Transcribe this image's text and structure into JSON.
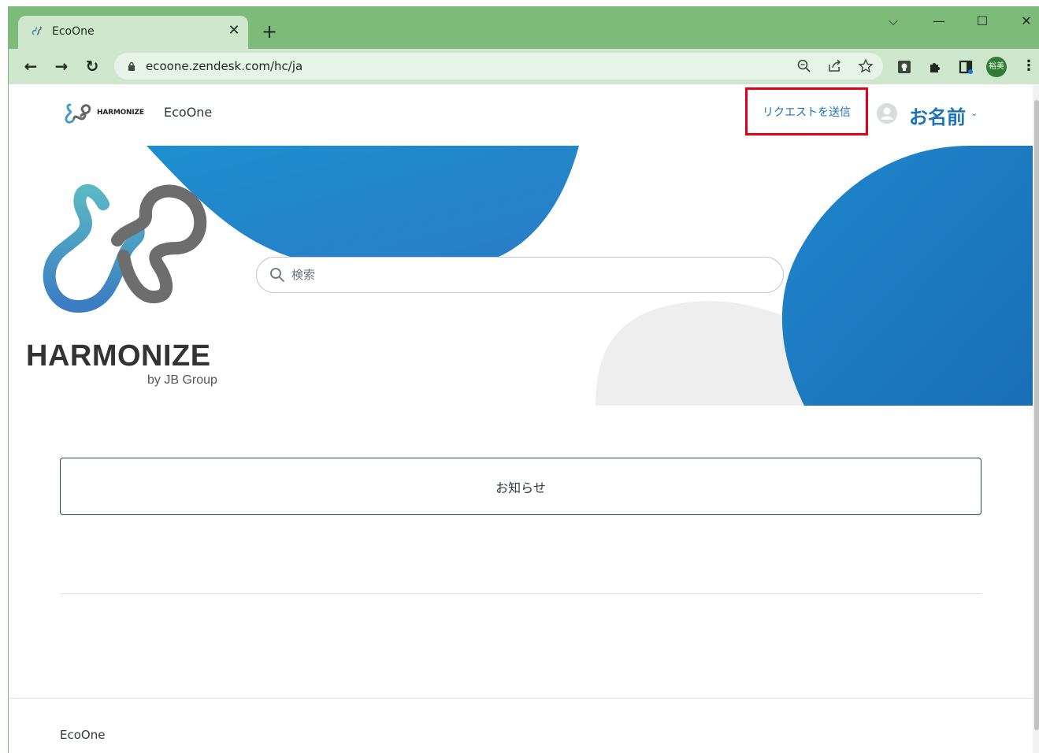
{
  "browser": {
    "tab_title": "EcoOne",
    "tab_close": "✕",
    "new_tab": "+",
    "url": "ecoone.zendesk.com/hc/ja",
    "profile_label": "裕美",
    "controls": {
      "chevron": "⌵",
      "minimize": "—",
      "maximize": "☐",
      "close": "✕"
    },
    "nav": {
      "back": "←",
      "forward": "→",
      "reload": "↻"
    },
    "menu": "⋮"
  },
  "header": {
    "logo_text": "HARMONIZE",
    "site_name": "EcoOne",
    "request_link": "リクエストを送信",
    "user_name": "お名前",
    "user_caret": "⌄"
  },
  "hero": {
    "search_placeholder": "検索",
    "brand": "HARMONIZE",
    "brand_sub": "by JB Group"
  },
  "main": {
    "categories": [
      {
        "label": "お知らせ"
      }
    ]
  },
  "footer": {
    "name": "EcoOne"
  },
  "colors": {
    "accent": "#1f73b7",
    "highlight": "#e60012",
    "browser_frame": "#7dbb7a",
    "browser_toolbar": "#cde6cc"
  }
}
